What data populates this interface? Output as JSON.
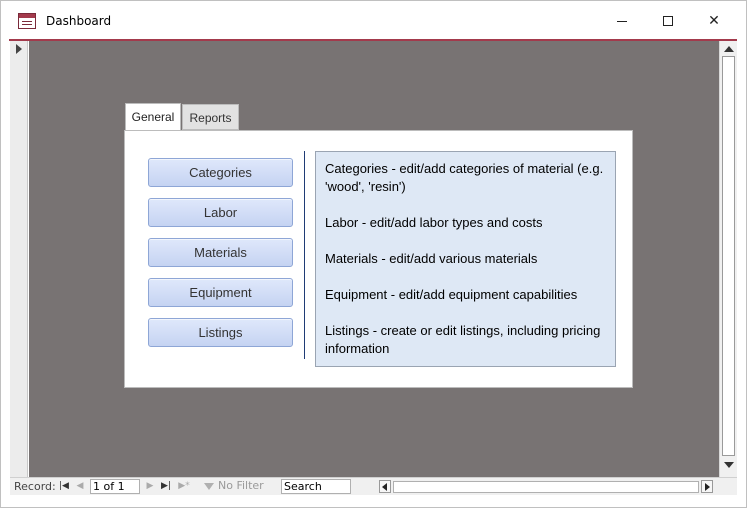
{
  "window": {
    "title": "Dashboard",
    "minimize_glyph": "",
    "close_glyph": "✕"
  },
  "tabs": [
    {
      "label": "General",
      "active": true
    },
    {
      "label": "Reports",
      "active": false
    }
  ],
  "buttons": [
    {
      "label": "Categories"
    },
    {
      "label": "Labor"
    },
    {
      "label": "Materials"
    },
    {
      "label": "Equipment"
    },
    {
      "label": "Listings"
    }
  ],
  "descriptions": [
    "Categories - edit/add categories of material (e.g. 'wood', 'resin')",
    "Labor - edit/add labor types and costs",
    "Materials - edit/add various materials",
    "Equipment - edit/add equipment capabilities",
    "Listings - create or edit listings, including pricing information"
  ],
  "status": {
    "record_label": "Record:",
    "record_value": "1 of 1",
    "first_glyph": "|◀",
    "prev_glyph": "◀",
    "next_glyph": "▶",
    "last_glyph": "▶|",
    "new_glyph": "▶*",
    "filter_label": "No Filter",
    "search_value": "Search"
  },
  "colors": {
    "accent": "#a33a4c",
    "form_background": "#787373",
    "button_fill": "#c5d3f2",
    "description_fill": "#dee8f5"
  }
}
